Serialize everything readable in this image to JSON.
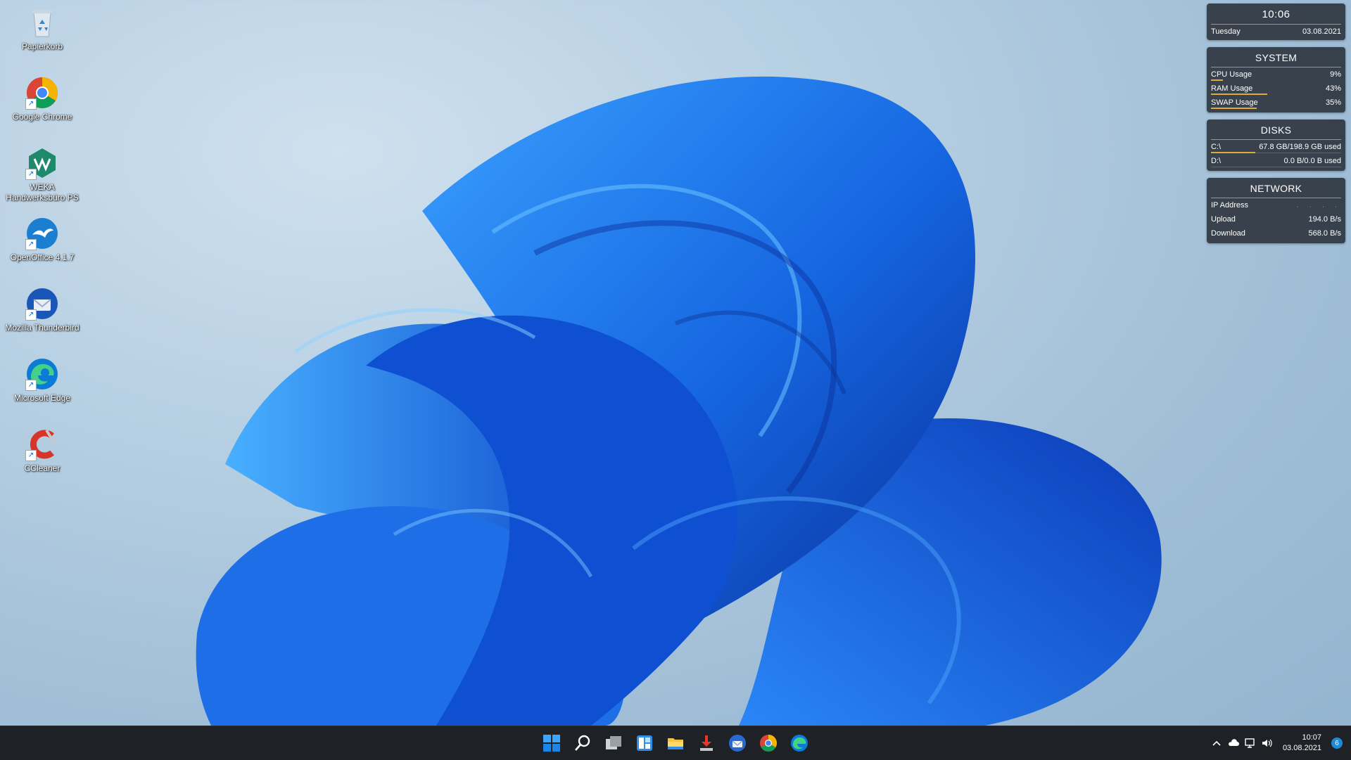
{
  "desktop": {
    "icons": [
      {
        "label": "Papierkorb"
      },
      {
        "label": "Google Chrome"
      },
      {
        "label": "WEKA Handwerksbüro PS"
      },
      {
        "label": "OpenOffice 4.1.7"
      },
      {
        "label": "Mozilla Thunderbird"
      },
      {
        "label": "Microsoft Edge"
      },
      {
        "label": "CCleaner"
      }
    ]
  },
  "gadgets": {
    "clock": {
      "time": "10:06",
      "day": "Tuesday",
      "date": "03.08.2021"
    },
    "system": {
      "title": "SYSTEM",
      "rows": [
        {
          "label": "CPU Usage",
          "value": "9%",
          "level": 0.09
        },
        {
          "label": "RAM Usage",
          "value": "43%",
          "level": 0.43
        },
        {
          "label": "SWAP Usage",
          "value": "35%",
          "level": 0.35
        }
      ]
    },
    "disks": {
      "title": "DISKS",
      "rows": [
        {
          "label": "C:\\",
          "value": "67.8 GB/198.9 GB used",
          "level": 0.34
        },
        {
          "label": "D:\\",
          "value": "0.0 B/0.0 B used",
          "level": 0
        }
      ]
    },
    "network": {
      "title": "NETWORK",
      "rows": [
        {
          "label": "IP Address",
          "value": ". . . ."
        },
        {
          "label": "Upload",
          "value": "194.0 B/s"
        },
        {
          "label": "Download",
          "value": "568.0 B/s"
        }
      ]
    }
  },
  "taskbar": {
    "apps": [
      "start-icon",
      "search-icon",
      "task-view-icon",
      "widgets-icon",
      "file-explorer-icon",
      "download-app-icon",
      "thunderbird-icon",
      "chrome-icon",
      "edge-icon"
    ],
    "tray": {
      "time": "10:07",
      "date": "03.08.2021",
      "notifications": "6"
    }
  },
  "colors": {
    "accent_bar": "#e2a93b",
    "taskbar_bg": "#1e2226",
    "panel_bg": "#262c34",
    "notification_badge": "#1e8ad6"
  }
}
